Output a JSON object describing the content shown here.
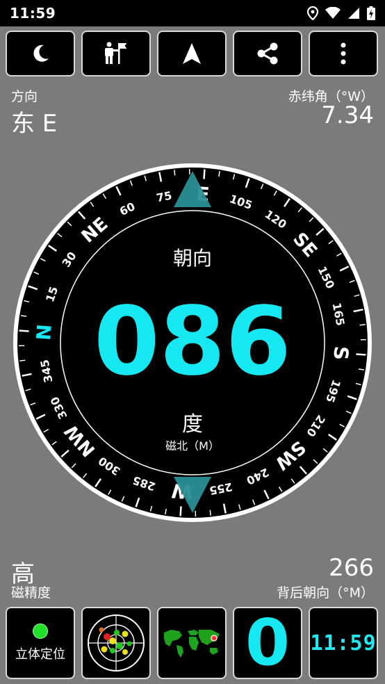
{
  "status_bar": {
    "time": "11:59"
  },
  "toolbar": {
    "buttons": [
      {
        "icon": "moon-icon"
      },
      {
        "icon": "hiker-flag-icon"
      },
      {
        "icon": "navigation-arrow-icon"
      },
      {
        "icon": "share-icon"
      },
      {
        "icon": "more-vert-icon"
      }
    ]
  },
  "direction": {
    "label": "方向",
    "value": "东 E"
  },
  "declination": {
    "label": "赤纬角（°W）",
    "value": "7.34"
  },
  "compass": {
    "heading_label": "朝向",
    "heading_value": "086",
    "unit": "度",
    "reference": "磁北（M）",
    "cardinals": [
      "N",
      "NE",
      "E",
      "SE",
      "S",
      "SW",
      "W",
      "NW"
    ],
    "degree_labels": [
      "15",
      "30",
      "60",
      "75",
      "105",
      "120",
      "150",
      "165",
      "195",
      "210",
      "240",
      "255",
      "285",
      "300",
      "330",
      "345"
    ],
    "colors": {
      "accent": "#16e8f2",
      "marker": "#2a8f95",
      "ring": "#ffffff",
      "face": "#000000"
    }
  },
  "accuracy": {
    "value": "高",
    "label": "磁精度"
  },
  "back_heading": {
    "value": "266",
    "label": "背后朝向（°M）"
  },
  "bottom": {
    "stereo_label": "立体定位",
    "big_digit": "0",
    "clock": "11:59"
  }
}
